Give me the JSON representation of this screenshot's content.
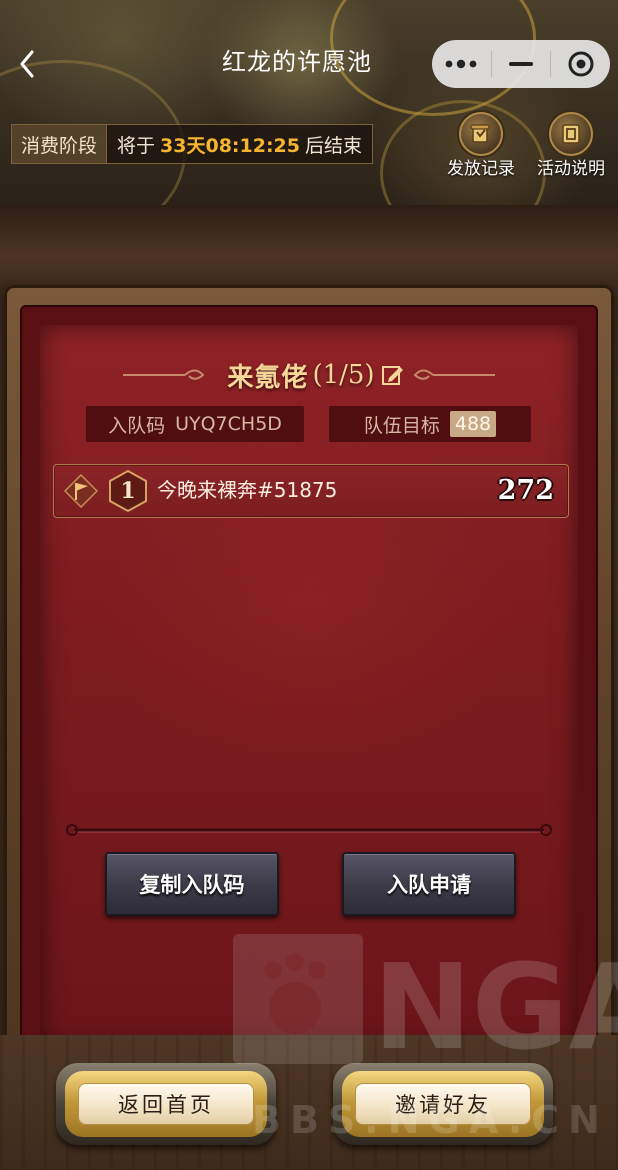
{
  "header": {
    "title": "红龙的许愿池",
    "phase_tag": "消费阶段",
    "phase_prefix": "将于",
    "phase_countdown": "33天08:12:25",
    "phase_suffix": "后结束",
    "actions": [
      {
        "label": "发放记录",
        "icon": "scroll-icon"
      },
      {
        "label": "活动说明",
        "icon": "book-icon"
      }
    ]
  },
  "team": {
    "name": "来氪佬",
    "count": "(1/5)",
    "code_label": "入队码",
    "code_value": "UYQ7CH5D",
    "target_label": "队伍目标",
    "target_value": "488",
    "members": [
      {
        "rank": "1",
        "name": "今晚来裸奔#51875",
        "score": "272",
        "icon": "flag-icon"
      }
    ]
  },
  "buttons": {
    "copy_code": "复制入队码",
    "join_request": "入队申请",
    "back_home": "返回首页",
    "invite_friends": "邀请好友"
  },
  "watermark": {
    "logo": "NGA",
    "site": "BBS.NGA.CN"
  },
  "colors": {
    "countdown": "#f6b52e",
    "panel_red": "#7a1b1e",
    "gold_title": "#f7d69a"
  }
}
